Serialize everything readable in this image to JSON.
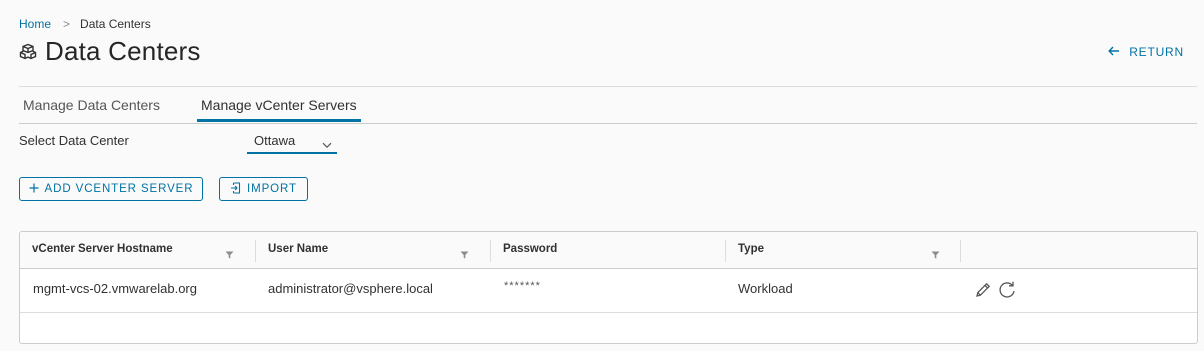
{
  "breadcrumb": {
    "home": "Home",
    "separator": ">",
    "current": "Data Centers"
  },
  "page": {
    "title": "Data Centers",
    "icon": "datacenter-icon",
    "return_label": "RETURN"
  },
  "tabs": [
    {
      "label": "Manage Data Centers",
      "active": false
    },
    {
      "label": "Manage vCenter Servers",
      "active": true
    }
  ],
  "select_data_center": {
    "label": "Select Data Center",
    "value": "Ottawa"
  },
  "buttons": {
    "add_label": "ADD VCENTER SERVER",
    "import_label": "IMPORT"
  },
  "grid": {
    "columns": [
      "vCenter Server Hostname",
      "User Name",
      "Password",
      "Type"
    ],
    "rows": [
      {
        "hostname": "mgmt-vcs-02.vmwarelab.org",
        "username": "administrator@vsphere.local",
        "password": "*******",
        "type": "Workload"
      }
    ]
  },
  "colors": {
    "accent": "#0072a3",
    "text": "#313131",
    "border": "#cccccc",
    "background": "#fafafa"
  }
}
